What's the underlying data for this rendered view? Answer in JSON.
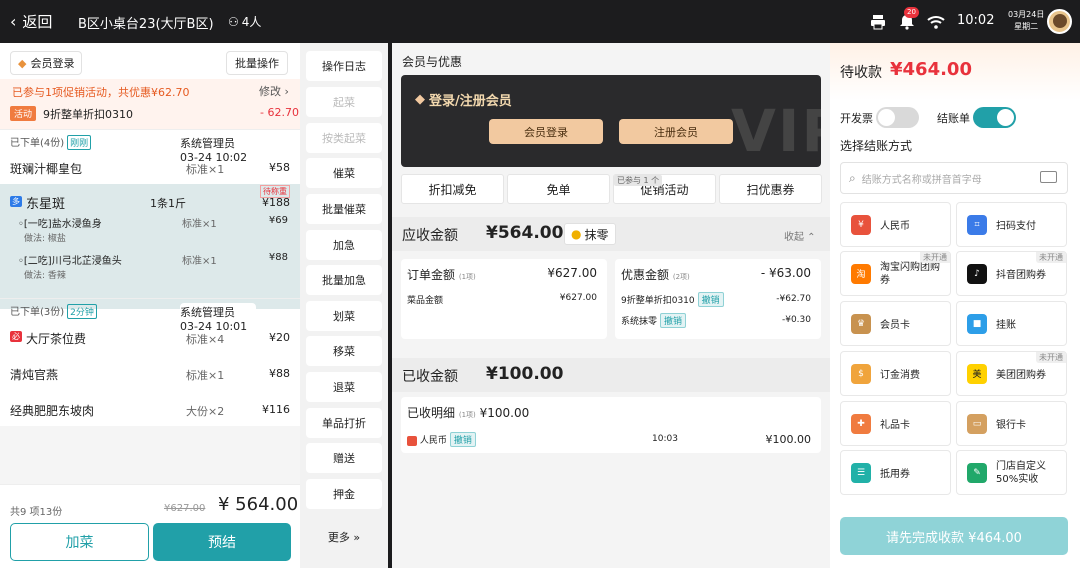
{
  "topbar": {
    "back_label": "返回",
    "table_name": "B区小桌台23(大厅B区)",
    "people": "4人",
    "notification_count": "20",
    "time": "10:02",
    "date": "03月24日",
    "weekday": "星期二"
  },
  "left": {
    "member_login": "会员登录",
    "batch_ops": "批量操作",
    "promo_line": "已参与1项促销活动，共优惠¥62.70",
    "modify": "修改",
    "promo_tag": "活动",
    "promo_name": "9折整单折扣0310",
    "promo_amount": "- 62.70",
    "order1": {
      "status": "已下单(4份)",
      "badge": "刚刚",
      "operator": "系统管理员 03-24 10:02"
    },
    "items1": [
      {
        "name": "斑斓汁椰皇包",
        "qty": "标准×1",
        "price": "¥58"
      },
      {
        "name": "东星斑",
        "qty": "1条1斤",
        "price": "¥188",
        "tag": "待称重",
        "prefix": "多"
      },
      {
        "name": "◦[一吃]盐水浸鱼身",
        "qty": "标准×1",
        "price": "¥69",
        "method": "做法:  椒盐"
      },
      {
        "name": "◦[二吃]川弓北芷浸鱼头",
        "qty": "标准×1",
        "price": "¥88",
        "method": "做法:  香辣"
      }
    ],
    "order2": {
      "status": "已下单(3份)",
      "badge": "2分钟",
      "operator": "系统管理员 03-24 10:01"
    },
    "items2": [
      {
        "name": "大厅茶位费",
        "qty": "标准×4",
        "price": "¥20",
        "prefix": "必"
      },
      {
        "name": "清炖官燕",
        "qty": "标准×1",
        "price": "¥88"
      },
      {
        "name": "经典肥肥东坡肉",
        "qty": "大份×2",
        "price": "¥116"
      }
    ],
    "count": "共9 项13份",
    "original_total": "¥627.00",
    "total": "¥ 564.00",
    "add_dish": "加菜",
    "settle": "预结"
  },
  "ops": [
    "操作日志",
    "起菜",
    "按类起菜",
    "催菜",
    "批量催菜",
    "加急",
    "批量加急",
    "划菜",
    "移菜",
    "退菜",
    "单品打折",
    "赠送",
    "押金"
  ],
  "ops_more": "更多",
  "center": {
    "title": "会员与优惠",
    "vip_title": "登录/注册会员",
    "vip_login": "会员登录",
    "vip_register": "注册会员",
    "vip_watermark": "VIP",
    "tabs": [
      "折扣减免",
      "免单",
      "促销活动",
      "扫优惠券"
    ],
    "tab_tag": "已参与 1 个",
    "receivable_label": "应收金额",
    "receivable": "¥564.00",
    "round_off": "抹零",
    "fold": "收起",
    "order_amount_label": "订单金额",
    "order_amount_count": "(1项)",
    "order_amount": "¥627.00",
    "dish_amount_label": "菜品金额",
    "dish_amount": "¥627.00",
    "discount_label": "优惠金额",
    "discount_count": "(2项)",
    "discount": "- ¥63.00",
    "discount_rows": [
      {
        "name": "9折整单折扣0310",
        "action": "撤销",
        "amount": "-¥62.70"
      },
      {
        "name": "系统抹零",
        "action": "撤销",
        "amount": "-¥0.30"
      }
    ],
    "received_label": "已收金额",
    "received": "¥100.00",
    "received_detail_label": "已收明细",
    "received_detail_count": "(1项)",
    "received_detail": "¥100.00",
    "payment_row": {
      "name": "人民币",
      "action": "撤销",
      "time": "10:03",
      "amount": "¥100.00"
    }
  },
  "right": {
    "pending_label": "待收款",
    "pending": "¥464.00",
    "invoice": "开发票",
    "bill": "结账单",
    "choose": "选择结账方式",
    "search_placeholder": "结账方式名称或拼音首字母",
    "methods": [
      {
        "name": "人民币",
        "color": "#e8523c"
      },
      {
        "name": "扫码支付",
        "color": "#3b7be8"
      },
      {
        "name": "淘宝闪购团购券",
        "color": "#ff7a00",
        "tag": "未开通"
      },
      {
        "name": "抖音团购券",
        "color": "#111111",
        "tag": "未开通"
      },
      {
        "name": "会员卡",
        "color": "#c8924f"
      },
      {
        "name": "挂账",
        "color": "#2d9ee8"
      },
      {
        "name": "订金消费",
        "color": "#f0a43c"
      },
      {
        "name": "美团团购券",
        "color": "#ffd100",
        "tag": "未开通"
      },
      {
        "name": "礼品卡",
        "color": "#f07b3f"
      },
      {
        "name": "银行卡",
        "color": "#d4a060"
      },
      {
        "name": "抵用券",
        "color": "#21b1a8"
      },
      {
        "name": "门店自定义50%实收",
        "color": "#21a86a"
      }
    ],
    "finish": "请先完成收款 ¥464.00"
  }
}
